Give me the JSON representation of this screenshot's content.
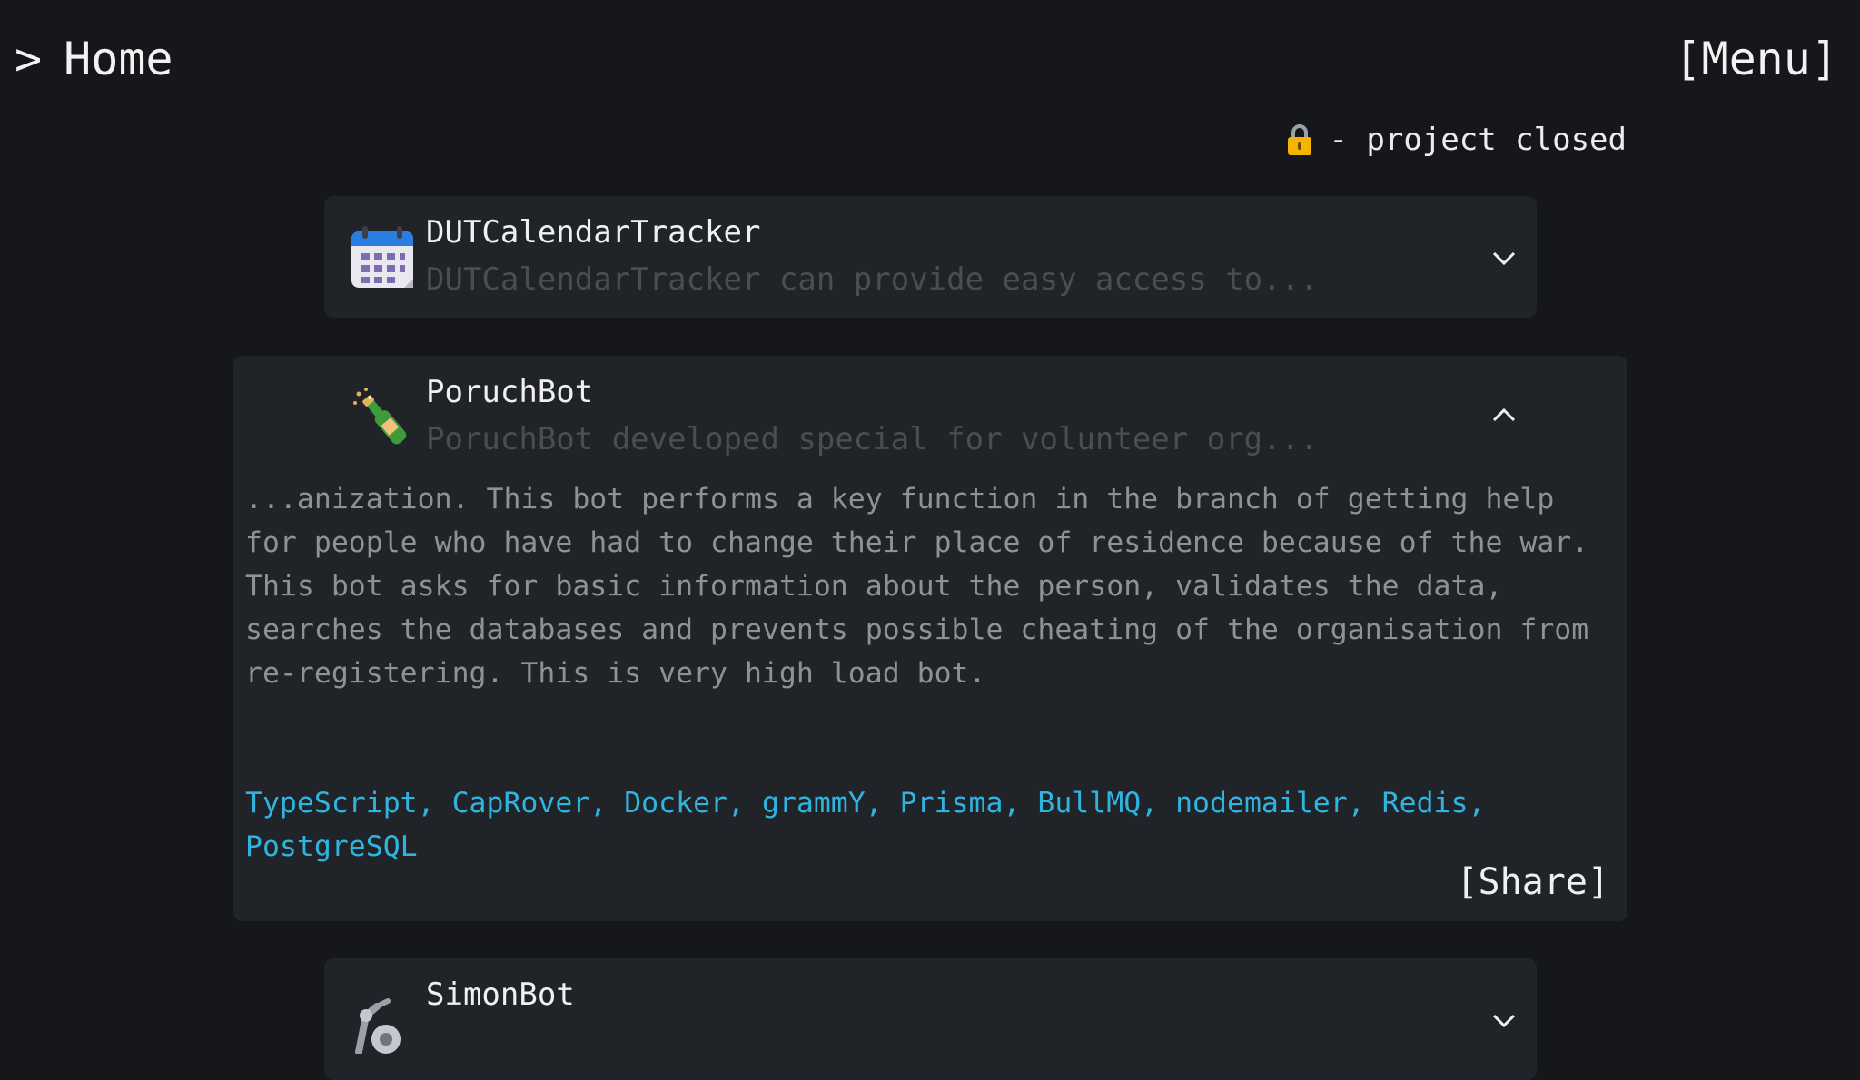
{
  "header": {
    "breadcrumb_arrow": ">",
    "title": "Home",
    "menu_label": "[Menu]"
  },
  "legend": {
    "icon": "lock-icon",
    "text": "- project closed"
  },
  "projects": [
    {
      "title": "DUTCalendarTracker",
      "subtitle": "DUTCalendarTracker can provide easy access to...",
      "icon": "calendar-icon",
      "expanded": false
    },
    {
      "title": "PoruchBot",
      "subtitle": "PoruchBot developed special for volunteer org...",
      "icon": "champagne-bottle-icon",
      "expanded": true,
      "description": "...anization. This bot performs a key function in the branch of getting help for people who have had to change their place of residence because of the war. This bot asks for basic information about the person, validates the data, searches the databases and prevents possible cheating of the organisation from re-registering. This is very high load bot.",
      "technologies": "TypeScript, CapRover, Docker, grammY, Prisma, BullMQ, nodemailer, Redis, PostgreSQL",
      "share_label": "[Share]"
    },
    {
      "title": "SimonBot",
      "subtitle": "",
      "icon": "robot-arm-icon",
      "expanded": false
    }
  ],
  "colors": {
    "background": "#16171a",
    "card": "#202327",
    "tech_link": "#2fb4e0",
    "muted_text": "#8e9196",
    "faded_subtitle": "#4a4d52"
  }
}
